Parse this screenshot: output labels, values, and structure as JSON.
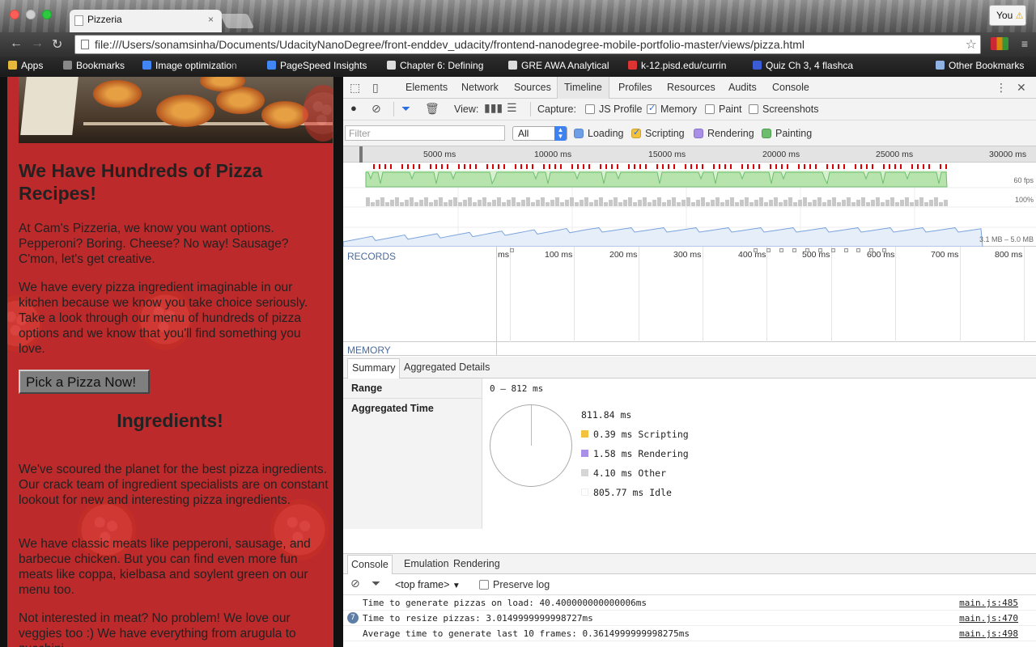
{
  "browser": {
    "tab_title": "Pizzeria",
    "tab_close": "×",
    "profile_label": "You",
    "url": "file:///Users/sonamsinha/Documents/UdacityNanoDegree/front-enddev_udacity/frontend-nanodegree-mobile-portfolio-master/views/pizza.html",
    "bookmarks": [
      {
        "label": "Apps",
        "icon": "apps-grid-icon",
        "color": "#e8b83c"
      },
      {
        "label": "Bookmarks",
        "icon": "star-icon",
        "color": "#888"
      },
      {
        "label": "Image optimizatio",
        "fade": "n",
        "icon": "google-icon",
        "color": "#4285f4"
      },
      {
        "label": "PageSpeed Insights",
        "icon": "pagespeed-icon",
        "color": "#4285f4"
      },
      {
        "label": "Chapter 6: Defining",
        "icon": "page-icon",
        "color": "#ddd"
      },
      {
        "label": "GRE AWA Analytical",
        "icon": "page-icon",
        "color": "#ddd"
      },
      {
        "label": "k-12.pisd.edu/currin",
        "icon": "pisd-icon",
        "color": "#d33"
      },
      {
        "label": "Quiz Ch 3, 4 flashca",
        "icon": "quizlet-icon",
        "color": "#3b5cd6"
      },
      {
        "label": "Other Bookmarks",
        "icon": "folder-icon",
        "color": "#8fb4e3"
      }
    ]
  },
  "page": {
    "heading": "We Have Hundreds of Pizza Recipes!",
    "para1": "At Cam's Pizzeria, we know you want options. Pepperoni? Boring. Cheese? No way! Sausage? C'mon, let's get creative.",
    "para2": "We have every pizza ingredient imaginable in our kitchen because we know you take choice seriously. Take a look through our menu of hundreds of pizza options and we know that you'll find something you love.",
    "button": "Pick a Pizza Now!",
    "ingredients_heading": "Ingredients!",
    "para3": "We've scoured the planet for the best pizza ingredients. Our crack team of ingredient specialists are on constant lookout for new and interesting pizza ingredients.",
    "para4": "We have classic meats like pepperoni, sausage, and barbecue chicken. But you can find even more fun meats like coppa, kielbasa and soylent green on our menu too.",
    "para5": "Not interested in meat? No problem! We love our veggies too :) We have everything from arugula to zucchini."
  },
  "devtools": {
    "tabs": [
      "Elements",
      "Network",
      "Sources",
      "Timeline",
      "Profiles",
      "Resources",
      "Audits",
      "Console"
    ],
    "active_tab": "Timeline",
    "view_label": "View:",
    "capture_label": "Capture:",
    "capture": [
      {
        "label": "JS Profile",
        "checked": false
      },
      {
        "label": "Memory",
        "checked": true
      },
      {
        "label": "Paint",
        "checked": false
      },
      {
        "label": "Screenshots",
        "checked": false
      }
    ],
    "filter_placeholder": "Filter",
    "filter_select": "All",
    "categories": [
      {
        "label": "Loading",
        "color": "#6e9ee6",
        "checked": false
      },
      {
        "label": "Scripting",
        "color": "#f2c13d",
        "checked": true
      },
      {
        "label": "Rendering",
        "color": "#a98fe6",
        "checked": false
      },
      {
        "label": "Painting",
        "color": "#6ebd6e",
        "checked": false
      }
    ],
    "overview_ticks": [
      "5000 ms",
      "10000 ms",
      "15000 ms",
      "20000 ms",
      "25000 ms",
      "30000 ms"
    ],
    "overview_fps": "60 fps",
    "overview_cpu": "100%",
    "overview_memory": "3.1 MB – 5.0 MB",
    "records_label": "RECORDS",
    "records_ticks": [
      "ms",
      "100 ms",
      "200 ms",
      "300 ms",
      "400 ms",
      "500 ms",
      "600 ms",
      "700 ms",
      "800 ms"
    ],
    "memory_label": "MEMORY",
    "summary_tabs": [
      "Summary",
      "Aggregated Details"
    ],
    "range_label": "Range",
    "range_value": "0 – 812 ms",
    "aggregated_label": "Aggregated Time",
    "total_time": "811.84 ms",
    "legend": [
      {
        "label": "0.39 ms Scripting",
        "color": "#f2c13d"
      },
      {
        "label": "1.58 ms Rendering",
        "color": "#a98fe6"
      },
      {
        "label": "4.10 ms Other",
        "color": "#d6d6d6"
      },
      {
        "label": "805.77 ms Idle",
        "color": "#ffffff"
      }
    ],
    "drawer_tabs": [
      "Console",
      "Emulation",
      "Rendering"
    ],
    "console_context": "<top frame>",
    "preserve_log": "Preserve log",
    "console_lines": [
      {
        "msg": "Time to generate pizzas on load: 40.400000000000006ms",
        "src": "main.js:485",
        "badge": ""
      },
      {
        "msg": "Time to resize pizzas: 3.0149999999998727ms",
        "src": "main.js:470",
        "badge": "7"
      },
      {
        "msg": "Average time to generate last 10 frames: 0.3614999999998275ms",
        "src": "main.js:498",
        "badge": ""
      }
    ]
  }
}
